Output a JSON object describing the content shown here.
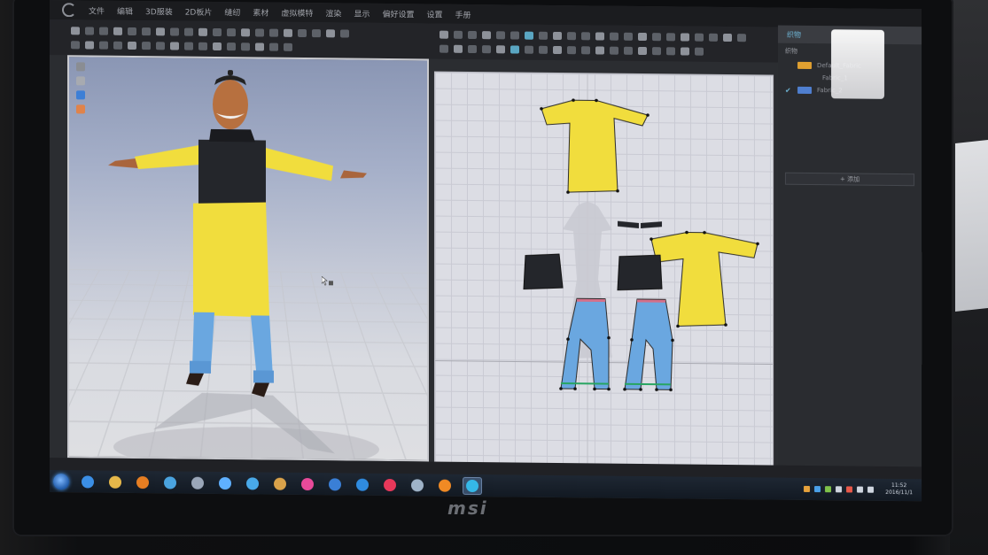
{
  "menu": {
    "items": [
      "文件",
      "编辑",
      "3D服装",
      "2D板片",
      "缝纫",
      "素材",
      "虚拟模特",
      "渲染",
      "显示",
      "偏好设置",
      "设置",
      "手册"
    ]
  },
  "object_browser": {
    "tab_label": "织物",
    "subheader": "织物",
    "fabrics": [
      {
        "label": "Default_Fabric",
        "swatch_color": "#e0a030",
        "checked": false
      },
      {
        "label": "Fabric_1",
        "swatch_color": "",
        "checked": false
      },
      {
        "label": "Fabric_2",
        "swatch_color": "#4f7fd0",
        "checked": true
      }
    ],
    "button_label": "+ 添加"
  },
  "colors": {
    "garment_yellow": "#f1dd3d",
    "trousers_blue": "#6aa7e0",
    "vest_black": "#24262b",
    "waistband_pink": "#d4708a",
    "hem_green": "#27a561",
    "accent_cyan": "#6fb6d6"
  },
  "taskbar": {
    "apps": [
      {
        "name": "ie",
        "color": "#3b8fe6"
      },
      {
        "name": "explorer",
        "color": "#e6b84a"
      },
      {
        "name": "media",
        "color": "#e67e22"
      },
      {
        "name": "app-blue",
        "color": "#4aa3df"
      },
      {
        "name": "network",
        "color": "#9aa6b8"
      },
      {
        "name": "player",
        "color": "#5fb0ff"
      },
      {
        "name": "tool",
        "color": "#49a9e8"
      },
      {
        "name": "package",
        "color": "#d9a24a"
      },
      {
        "name": "color-wheel",
        "color": "#e84a9a"
      },
      {
        "name": "globe",
        "color": "#3a7fd6"
      },
      {
        "name": "media-2",
        "color": "#2f8be0"
      },
      {
        "name": "app-red",
        "color": "#e8385a"
      },
      {
        "name": "app-gray",
        "color": "#9fb3c8"
      },
      {
        "name": "app-orange",
        "color": "#f08a24"
      },
      {
        "name": "clo",
        "color": "#35b8e8",
        "active": true
      }
    ],
    "clock": {
      "time": "11:52",
      "date": "2016/11/1"
    }
  },
  "monitor": {
    "brand": "msi"
  }
}
